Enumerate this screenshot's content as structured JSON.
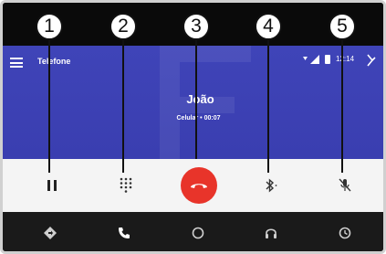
{
  "app": {
    "title": "Telefone"
  },
  "status_bar": {
    "time": "12:14",
    "signal_label": "▾◢"
  },
  "call": {
    "contact_name": "João",
    "detail": "Celular • 00:07"
  },
  "controls": [
    {
      "name": "pause",
      "icon": "pause-icon"
    },
    {
      "name": "keypad",
      "icon": "dialpad-icon"
    },
    {
      "name": "end-call",
      "icon": "phone-hangup-icon"
    },
    {
      "name": "bluetooth-audio",
      "icon": "bluetooth-icon"
    },
    {
      "name": "mute",
      "icon": "mic-off-icon"
    }
  ],
  "nav": [
    {
      "name": "maps",
      "icon": "navigation-icon"
    },
    {
      "name": "phone",
      "icon": "phone-icon"
    },
    {
      "name": "home",
      "icon": "home-circle-icon"
    },
    {
      "name": "audio",
      "icon": "headphones-icon"
    },
    {
      "name": "recents",
      "icon": "clock-icon"
    }
  ],
  "callouts": [
    "1",
    "2",
    "3",
    "4",
    "5"
  ],
  "colors": {
    "call_background": "#3f44b8",
    "end_call": "#e8342a",
    "control_bar": "#f4f4f4",
    "nav_bar": "#1a1a1a"
  }
}
